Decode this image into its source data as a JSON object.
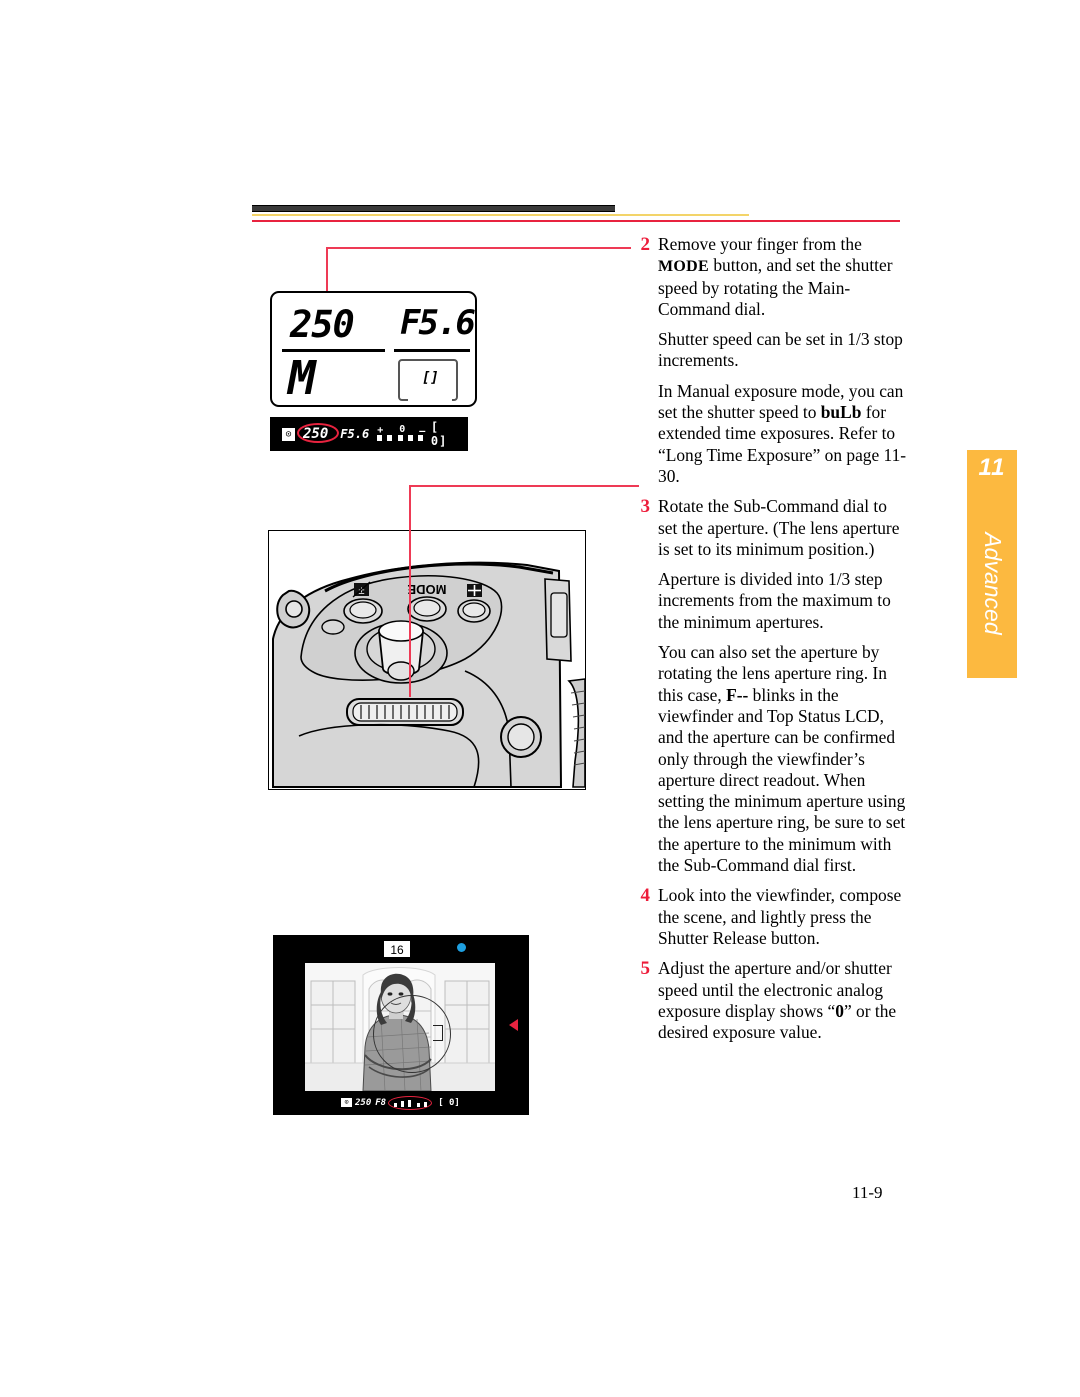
{
  "page": {
    "number": "11-9",
    "chapter_tab": {
      "number": "11",
      "label": "Advanced"
    },
    "accent_red": "#ed1c3a",
    "accent_orange": "#fcb940",
    "rule_yellow": "#f3d469"
  },
  "steps": [
    {
      "num": "2",
      "paragraphs": [
        {
          "parts": [
            "Remove your finger from the ",
            "MODE",
            " button, and set the shutter speed by rotating the Main-Command dial."
          ],
          "smallcaps_index": 1
        },
        {
          "text": "Shutter speed can be set in 1/3 stop increments."
        },
        {
          "parts": [
            "In Manual exposure mode, you can set the shutter speed to ",
            "buLb",
            " for extended time exposures. Refer to “Long Time Exposure” on page 11-30."
          ],
          "bold_index": 1
        }
      ]
    },
    {
      "num": "3",
      "paragraphs": [
        {
          "text": "Rotate the Sub-Command dial to set the aperture. (The lens aperture is set to its minimum position.)"
        },
        {
          "text": "Aperture is divided into 1/3 step increments from the maximum to the minimum apertures."
        },
        {
          "parts": [
            "You can also set the aperture by rotating the lens aperture ring. In this case, ",
            "F--",
            " blinks in the viewfinder and Top Status LCD, and the aperture can be confirmed only through the viewfinder’s aperture direct readout. When setting the minimum aperture using the lens aperture ring, be sure to set the aperture to the minimum with the Sub-Command dial first."
          ],
          "bold_index": 1
        }
      ]
    },
    {
      "num": "4",
      "paragraphs": [
        {
          "text": "Look into the viewfinder, compose the scene, and lightly press the Shutter Release button."
        }
      ]
    },
    {
      "num": "5",
      "paragraphs": [
        {
          "parts": [
            "Adjust the aperture and/or shutter speed until the electronic analog exposure display shows “",
            "0",
            "” or the desired exposure value."
          ],
          "bold_index": 1
        }
      ]
    }
  ],
  "step_text": {
    "s2_p1_a": "Remove your finger from the ",
    "s2_p1_sc": "MODE",
    "s2_p1_b": " button, and set the shutter speed by rotating the Main-Command dial.",
    "s2_p2": "Shutter speed can be set in 1/3 stop increments.",
    "s2_p3_a": "In Manual exposure mode, you can set the shutter speed to ",
    "s2_p3_bold": "buLb",
    "s2_p3_b": " for extended time exposures. Refer to “Long Time Exposure” on page 11-30.",
    "s3_p1": "Rotate the Sub-Command dial to set the aperture. (The lens aperture is set to its minimum position.)",
    "s3_p2": "Aperture is divided into 1/3 step increments from the maximum to the minimum apertures.",
    "s3_p3_a": "You can also set the aperture by rotating the lens aperture ring. In this case, ",
    "s3_p3_bold": "F--",
    "s3_p3_b": " blinks in the viewfinder and Top Status LCD, and the aperture can be confirmed only through the viewfinder’s aperture direct readout. When setting the minimum aperture using the lens aperture ring, be sure to set the aperture to the minimum with the Sub-Command dial first.",
    "s4_p1": "Look into the viewfinder, compose the scene, and lightly press the Shutter Release button.",
    "s5_p1_a": "Adjust the aperture and/or shutter speed until the electronic analog exposure display shows “",
    "s5_p1_bold": "0",
    "s5_p1_b": "” or the desired exposure value."
  },
  "figures": {
    "top_status_lcd": {
      "shutter_speed": "250",
      "aperture": "F5.6",
      "exposure_mode": "M",
      "frame_mark": "[]"
    },
    "viewfinder_strip": {
      "metering_icon": "⊙",
      "shutter_speed": "250",
      "aperture": "F5.6",
      "scale_plus": "+",
      "scale_zero": "0",
      "scale_minus": "–",
      "frame_counter": "[ 0]"
    },
    "camera_top_view": {
      "button_labels": [
        "MODE"
      ],
      "exposure_comp_icon": "exposure-compensation-icon",
      "drive_mode_icon": "drive-mode-icon",
      "callout_target": "sub-command-dial"
    },
    "viewfinder_scene": {
      "focus_label": "16",
      "focus_dot_color": "#1e9fe0",
      "marker_color": "#e8233f",
      "strip": {
        "metering_icon": "⊙",
        "shutter_speed": "250",
        "aperture": "F8",
        "frame_counter": "[ 0]"
      }
    }
  }
}
